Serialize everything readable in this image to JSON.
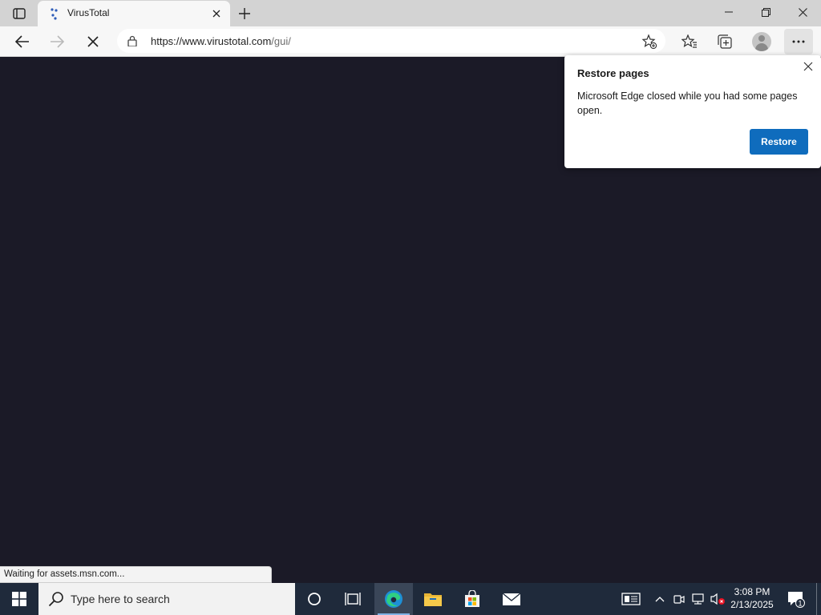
{
  "browser": {
    "tab": {
      "title": "VirusTotal"
    },
    "address": {
      "url_host": "https://www.virustotal.com",
      "url_path": "/gui/"
    }
  },
  "restore_popup": {
    "title": "Restore pages",
    "message": "Microsoft Edge closed while you had some pages open.",
    "button_label": "Restore"
  },
  "status_bar": {
    "text": "Waiting for assets.msn.com..."
  },
  "taskbar": {
    "search_placeholder": "Type here to search",
    "clock": {
      "time": "3:08 PM",
      "date": "2/13/2025"
    },
    "notification_count": "1",
    "apps": [
      "cortana-icon",
      "task-view-icon",
      "edge-icon",
      "file-explorer-icon",
      "store-icon",
      "mail-icon"
    ]
  },
  "colors": {
    "page_background": "#1b1a27",
    "restore_button": "#0f6cbd",
    "taskbar": "#1f2a3b",
    "tab_strip": "#d3d3d3"
  }
}
